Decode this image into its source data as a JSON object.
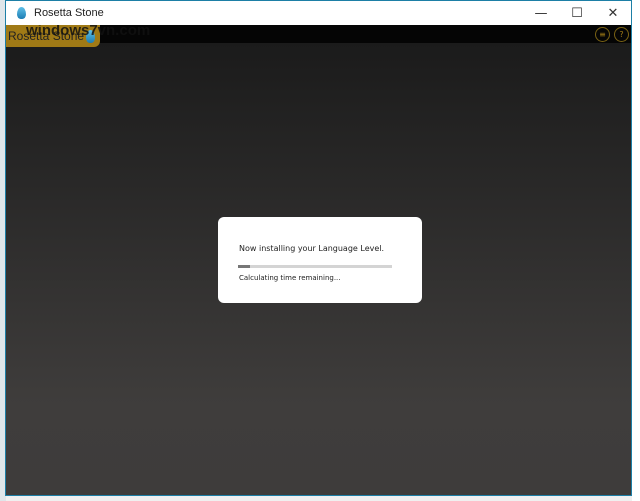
{
  "window": {
    "title": "Rosetta Stone",
    "buttons": [
      "minimize",
      "maximize",
      "close"
    ]
  },
  "logo": {
    "text": "Rosetta Stone"
  },
  "watermark": "windows7vn.com",
  "toolbar": {
    "icons": [
      "menu-icon",
      "help-icon"
    ]
  },
  "dialog": {
    "message": "Now installing your Language Level.",
    "status": "Calculating time remaining...",
    "progress_percent": 8
  },
  "colors": {
    "accent": "#a07a16",
    "window_border": "#1d7fa6"
  }
}
